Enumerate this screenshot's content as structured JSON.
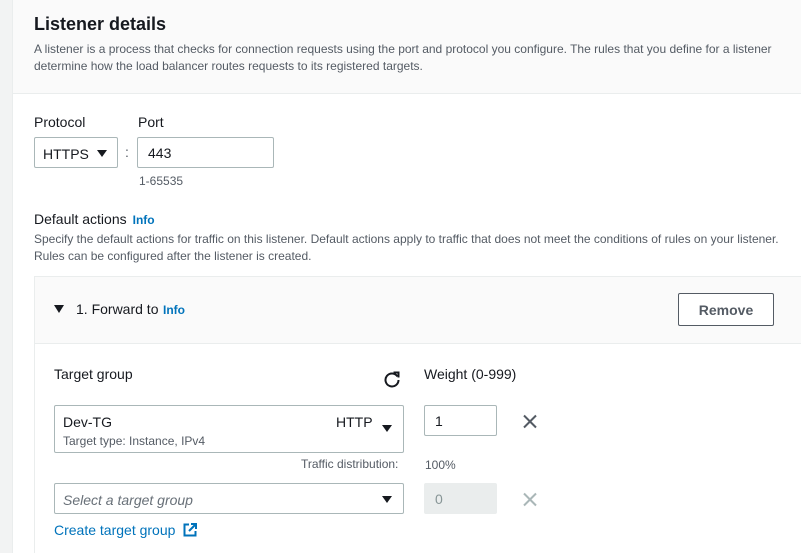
{
  "header": {
    "title": "Listener details",
    "description": "A listener is a process that checks for connection requests using the port and protocol you configure. The rules that you define for a listener determine how the load balancer routes requests to its registered targets."
  },
  "listener": {
    "protocol_label": "Protocol",
    "protocol_value": "HTTPS",
    "separator": ":",
    "port_label": "Port",
    "port_value": "443",
    "port_hint": "1-65535"
  },
  "default_actions": {
    "label": "Default actions",
    "info": "Info",
    "description": "Specify the default actions for traffic on this listener. Default actions apply to traffic that does not meet the conditions of rules on your listener. Rules can be configured after the listener is created."
  },
  "forward": {
    "title": "1. Forward to",
    "info": "Info",
    "remove_label": "Remove",
    "target_group_label": "Target group",
    "weight_label": "Weight (0-999)",
    "rows": [
      {
        "name": "Dev-TG",
        "protocol": "HTTP",
        "subtext": "Target type: Instance, IPv4",
        "weight": "1",
        "traffic_label": "Traffic distribution:",
        "traffic_value": "100%"
      }
    ],
    "empty_select_placeholder": "Select a target group",
    "empty_weight": "0",
    "create_link": "Create target group"
  },
  "colors": {
    "link": "#0073bb",
    "border": "#aab7b8",
    "text": "#16191f",
    "muted": "#545b64"
  },
  "icons": [
    "caret-down-icon",
    "refresh-icon",
    "close-icon",
    "external-link-icon",
    "expanded-triangle-icon"
  ]
}
